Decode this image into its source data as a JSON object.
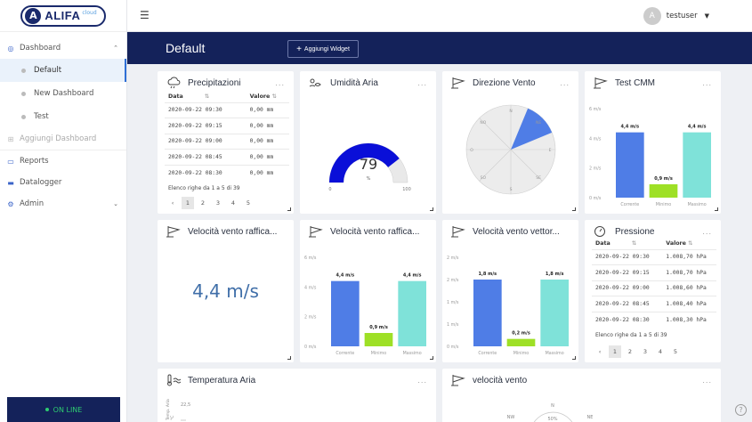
{
  "app": {
    "logo_text": "ALIFA",
    "logo_sub": "cloud",
    "logo_mark": "A"
  },
  "sidebar": {
    "dashboard": {
      "label": "Dashboard",
      "icon": "dashboard-icon"
    },
    "subitems": [
      {
        "label": "Default",
        "active": true
      },
      {
        "label": "New Dashboard",
        "active": false
      },
      {
        "label": "Test",
        "active": false
      }
    ],
    "add_dashboard": "Aggiungi Dashboard",
    "reports": "Reports",
    "datalogger": "Datalogger",
    "admin": "Admin",
    "status": "ON LINE"
  },
  "topbar": {
    "username": "testuser",
    "avatar_letter": "A"
  },
  "header": {
    "title": "Default",
    "add_widget": "Aggiungi Widget",
    "add_plus": "+"
  },
  "widgets": {
    "precipitazioni": {
      "title": "Precipitazioni",
      "menu": "...",
      "col_date": "Data",
      "col_value": "Valore",
      "sort_icons": [
        "⇅",
        "⇅"
      ],
      "rows": [
        [
          "2020-09-22 09:30",
          "0,00 mm"
        ],
        [
          "2020-09-22 09:15",
          "0,00 mm"
        ],
        [
          "2020-09-22 09:00",
          "0,00 mm"
        ],
        [
          "2020-09-22 08:45",
          "0,00 mm"
        ],
        [
          "2020-09-22 08:30",
          "0,00 mm"
        ]
      ],
      "footer": "Elenco righe da 1 a 5 di 39",
      "pages": [
        "‹",
        "1",
        "2",
        "3",
        "4",
        "5"
      ]
    },
    "umidita": {
      "title": "Umidità Aria",
      "menu": "...",
      "value": 79,
      "unit": "%",
      "min_label": "0",
      "max_label": "100"
    },
    "direzione": {
      "title": "Direzione Vento",
      "menu": "...",
      "labels": [
        "N",
        "NE",
        "E",
        "SE",
        "S",
        "SO",
        "O",
        "NO"
      ]
    },
    "test_cmm": {
      "title": "Test CMM",
      "menu": "..."
    },
    "vel_raffica_1": {
      "title": "Velocità vento raffica...",
      "menu": "...",
      "value": "4,4 m/s"
    },
    "vel_raffica_2": {
      "title": "Velocità vento raffica...",
      "menu": "..."
    },
    "vel_vettoriale": {
      "title": "Velocità vento vettor...",
      "menu": "..."
    },
    "pressione": {
      "title": "Pressione",
      "menu": "...",
      "col_date": "Data",
      "col_value": "Valore",
      "sort_icons": [
        "⇅",
        "⇅"
      ],
      "rows": [
        [
          "2020-09-22 09:30",
          "1.008,70 hPa"
        ],
        [
          "2020-09-22 09:15",
          "1.008,70 hPa"
        ],
        [
          "2020-09-22 09:00",
          "1.008,60 hPa"
        ],
        [
          "2020-09-22 08:45",
          "1.008,40 hPa"
        ],
        [
          "2020-09-22 08:30",
          "1.008,30 hPa"
        ]
      ],
      "footer": "Elenco righe da 1 a 5 di 39",
      "pages": [
        "‹",
        "1",
        "2",
        "3",
        "4",
        "5"
      ]
    },
    "temperatura": {
      "title": "Temperatura Aria",
      "menu": "...",
      "ytick": "22,5",
      "ylabel": "Temp. Aria",
      "ylabel_unit": "°C"
    },
    "velocita_vento": {
      "title": "velocità vento",
      "menu": "...",
      "labels": [
        "N",
        "NW",
        "NE"
      ],
      "pct": "50%"
    }
  },
  "chart_data": [
    {
      "type": "bar",
      "id": "test_cmm",
      "categories": [
        "Corrente",
        "Minimo",
        "Massimo"
      ],
      "values": [
        4.4,
        0.9,
        4.4
      ],
      "data_labels": [
        "4,4 m/s",
        "0,9 m/s",
        "4,4 m/s"
      ],
      "yticks": [
        "0 m/s",
        "2 m/s",
        "4 m/s",
        "6 m/s"
      ],
      "ylim": [
        0,
        6
      ],
      "colors": [
        "#4f7de6",
        "#9ee026",
        "#7fe2d9"
      ]
    },
    {
      "type": "bar",
      "id": "vel_raffica_2",
      "categories": [
        "Corrente",
        "Minimo",
        "Massimo"
      ],
      "values": [
        4.4,
        0.9,
        4.4
      ],
      "data_labels": [
        "4,4 m/s",
        "0,9 m/s",
        "4,4 m/s"
      ],
      "yticks": [
        "0 m/s",
        "2 m/s",
        "4 m/s",
        "6 m/s"
      ],
      "ylim": [
        0,
        6
      ],
      "colors": [
        "#4f7de6",
        "#9ee026",
        "#7fe2d9"
      ]
    },
    {
      "type": "bar",
      "id": "vel_vettoriale",
      "categories": [
        "Corrente",
        "Minimo",
        "Massimo"
      ],
      "values": [
        1.8,
        0.2,
        1.8
      ],
      "data_labels": [
        "1,8 m/s",
        "0,2 m/s",
        "1,8 m/s"
      ],
      "yticks": [
        "0 m/s",
        "1 m/s",
        "1 m/s",
        "2 m/s",
        "2 m/s"
      ],
      "ylim": [
        0,
        2.4
      ],
      "colors": [
        "#4f7de6",
        "#9ee026",
        "#7fe2d9"
      ]
    }
  ]
}
